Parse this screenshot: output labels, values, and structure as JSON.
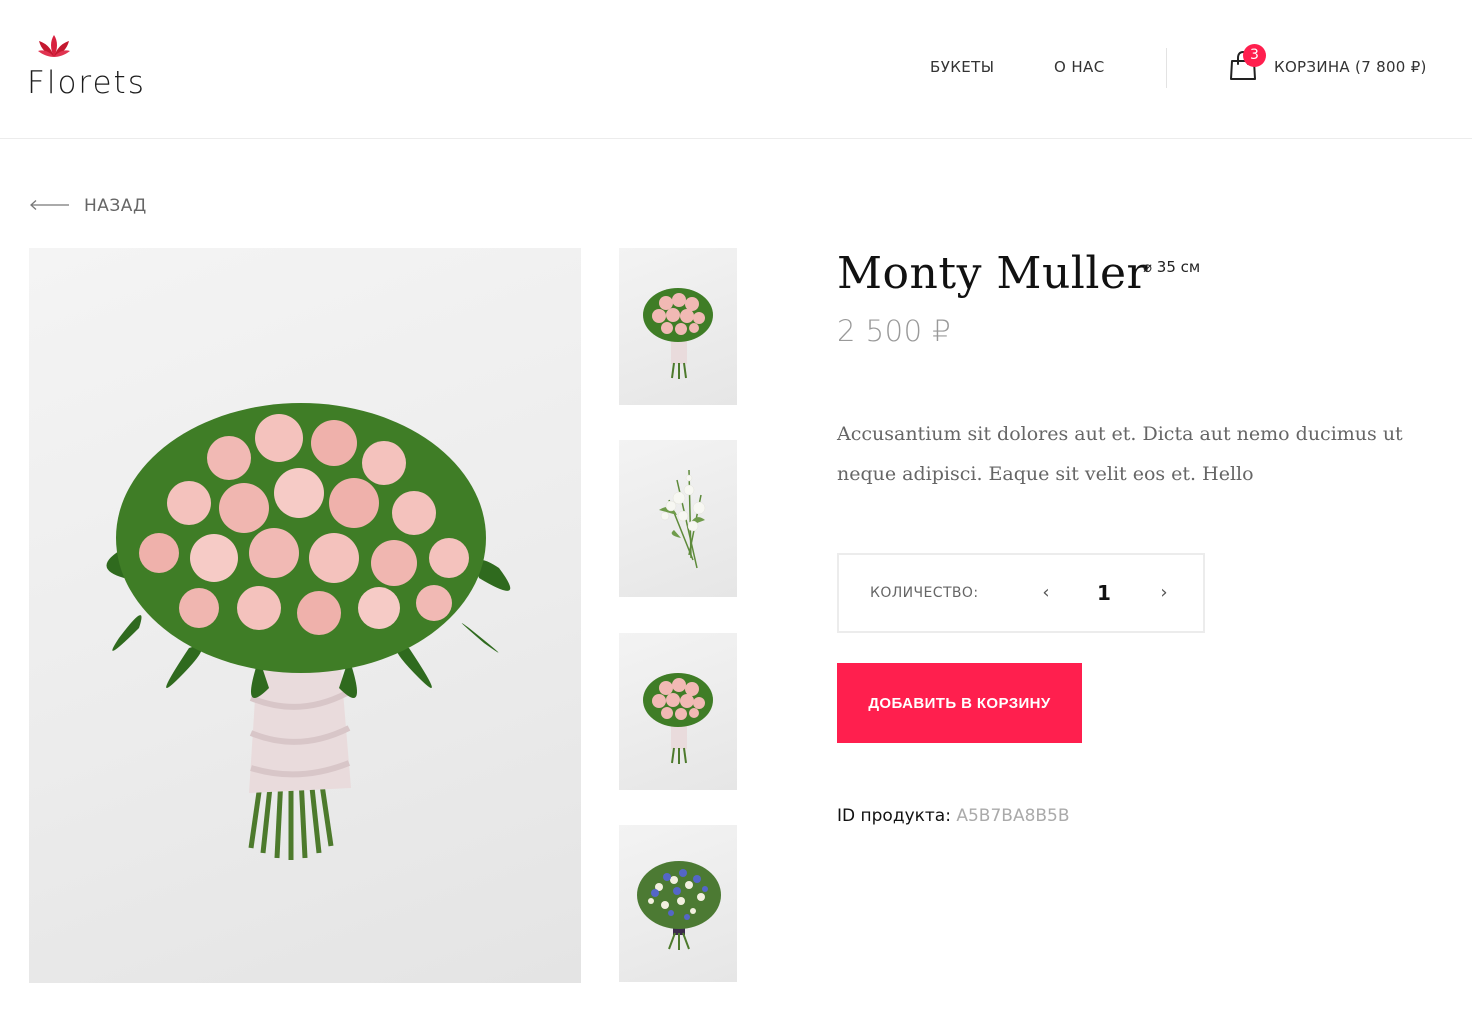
{
  "header": {
    "logo_text": "Florets",
    "nav": {
      "bouquets": "БУКЕТЫ",
      "about": "О НАС"
    },
    "cart": {
      "badge_count": "3",
      "label": "КОРЗИНА (7 800 ₽)",
      "icon": "shopping-bag-icon"
    }
  },
  "back": {
    "label": "НАЗАД",
    "icon": "arrow-left-icon"
  },
  "product": {
    "title": "Monty Muller",
    "size": "⌀ 35 см",
    "price": "2 500 ₽",
    "description": "Accusantium sit dolores aut et. Dicta aut nemo ducimus ut neque adipisci. Eaque sit velit eos et. Hello",
    "quantity_label": "КОЛИЧЕСТВО:",
    "quantity_value": "1",
    "quantity_dec": "‹",
    "quantity_inc": "›",
    "add_to_cart": "ДОБАВИТЬ В КОРЗИНУ",
    "id_label": "ID продукта:",
    "id_value": "A5B7BA8B5B"
  },
  "colors": {
    "accent": "#ff1f4e",
    "muted_text": "#999999",
    "border": "#ececec"
  }
}
